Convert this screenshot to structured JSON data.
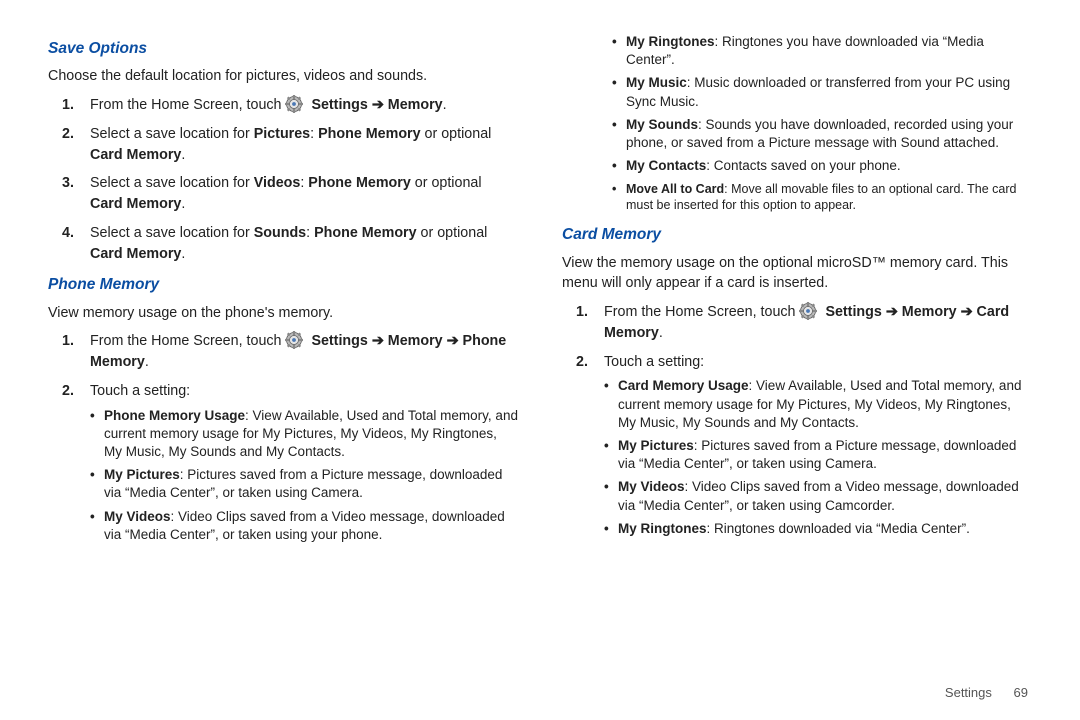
{
  "footer": {
    "label": "Settings",
    "page": "69"
  },
  "left": {
    "save_options": {
      "heading": "Save Options",
      "intro": "Choose the default location for pictures, videos and sounds.",
      "s1_a": "From the Home Screen, touch ",
      "s1_b": "Settings",
      "s1_c": "Memory",
      "s2_a": "Select a save location for ",
      "s2_pic": "Pictures",
      "s2_b": ": ",
      "s2_pm": "Phone Memory",
      "s2_c": " or optional ",
      "s2_cm": "Card Memory",
      "s3_a": "Select a save location for ",
      "s3_vid": "Videos",
      "s3_b": ": ",
      "s3_pm": "Phone Memory",
      "s3_c": " or optional ",
      "s3_cm": "Card Memory",
      "s4_a": "Select a save location for ",
      "s4_snd": "Sounds",
      "s4_b": ": ",
      "s4_pm": "Phone Memory",
      "s4_c": " or optional ",
      "s4_cm": "Card Memory"
    },
    "phone_memory": {
      "heading": "Phone Memory",
      "intro": "View memory usage on the phone's memory.",
      "s1_a": "From the Home Screen, touch ",
      "s1_b": "Settings",
      "s1_c": "Memory",
      "s1_d": "Phone Memory",
      "s2": "Touch a setting:",
      "b1_t": "Phone Memory Usage",
      "b1_d": ": View Available, Used and Total memory, and current memory usage for My Pictures, My Videos, My Ringtones, My Music, My Sounds and My Contacts.",
      "b2_t": "My Pictures",
      "b2_d": ": Pictures saved from a Picture message, downloaded via “Media Center”, or taken using Camera.",
      "b3_t": "My Videos",
      "b3_d": ": Video Clips saved from a Video message, downloaded via “Media Center”, or taken using your phone."
    }
  },
  "right": {
    "cont": {
      "b1_t": "My Ringtones",
      "b1_d": ": Ringtones you have downloaded via “Media Center”.",
      "b2_t": "My Music",
      "b2_d": ": Music downloaded or transferred from your PC using Sync Music.",
      "b3_t": "My Sounds",
      "b3_d": ": Sounds you have downloaded, recorded using your phone, or saved from a Picture message with Sound attached.",
      "b4_t": "My Contacts",
      "b4_d": ": Contacts saved on your phone.",
      "b5_t": "Move All to Card",
      "b5_d": ": Move all movable files to an optional card. The card must be inserted for this option to appear."
    },
    "card_memory": {
      "heading": "Card Memory",
      "intro": "View the memory usage on the optional microSD™ memory card. This menu will only appear if a card is inserted.",
      "s1_a": "From the Home Screen, touch ",
      "s1_b": "Settings",
      "s1_c": "Memory",
      "s1_d": "Card Memory",
      "s2": "Touch a setting:",
      "b1_t": "Card Memory Usage",
      "b1_d": ": View Available, Used and Total memory, and current memory usage for My Pictures, My Videos, My Ringtones, My Music, My Sounds and My Contacts.",
      "b2_t": "My Pictures",
      "b2_d": ": Pictures saved from a Picture message, downloaded via “Media Center”, or taken using Camera.",
      "b3_t": "My Videos",
      "b3_d": ": Video Clips saved from a Video message, downloaded via “Media Center”, or taken using Camcorder.",
      "b4_t": "My Ringtones",
      "b4_d": ": Ringtones downloaded via “Media Center”."
    }
  }
}
